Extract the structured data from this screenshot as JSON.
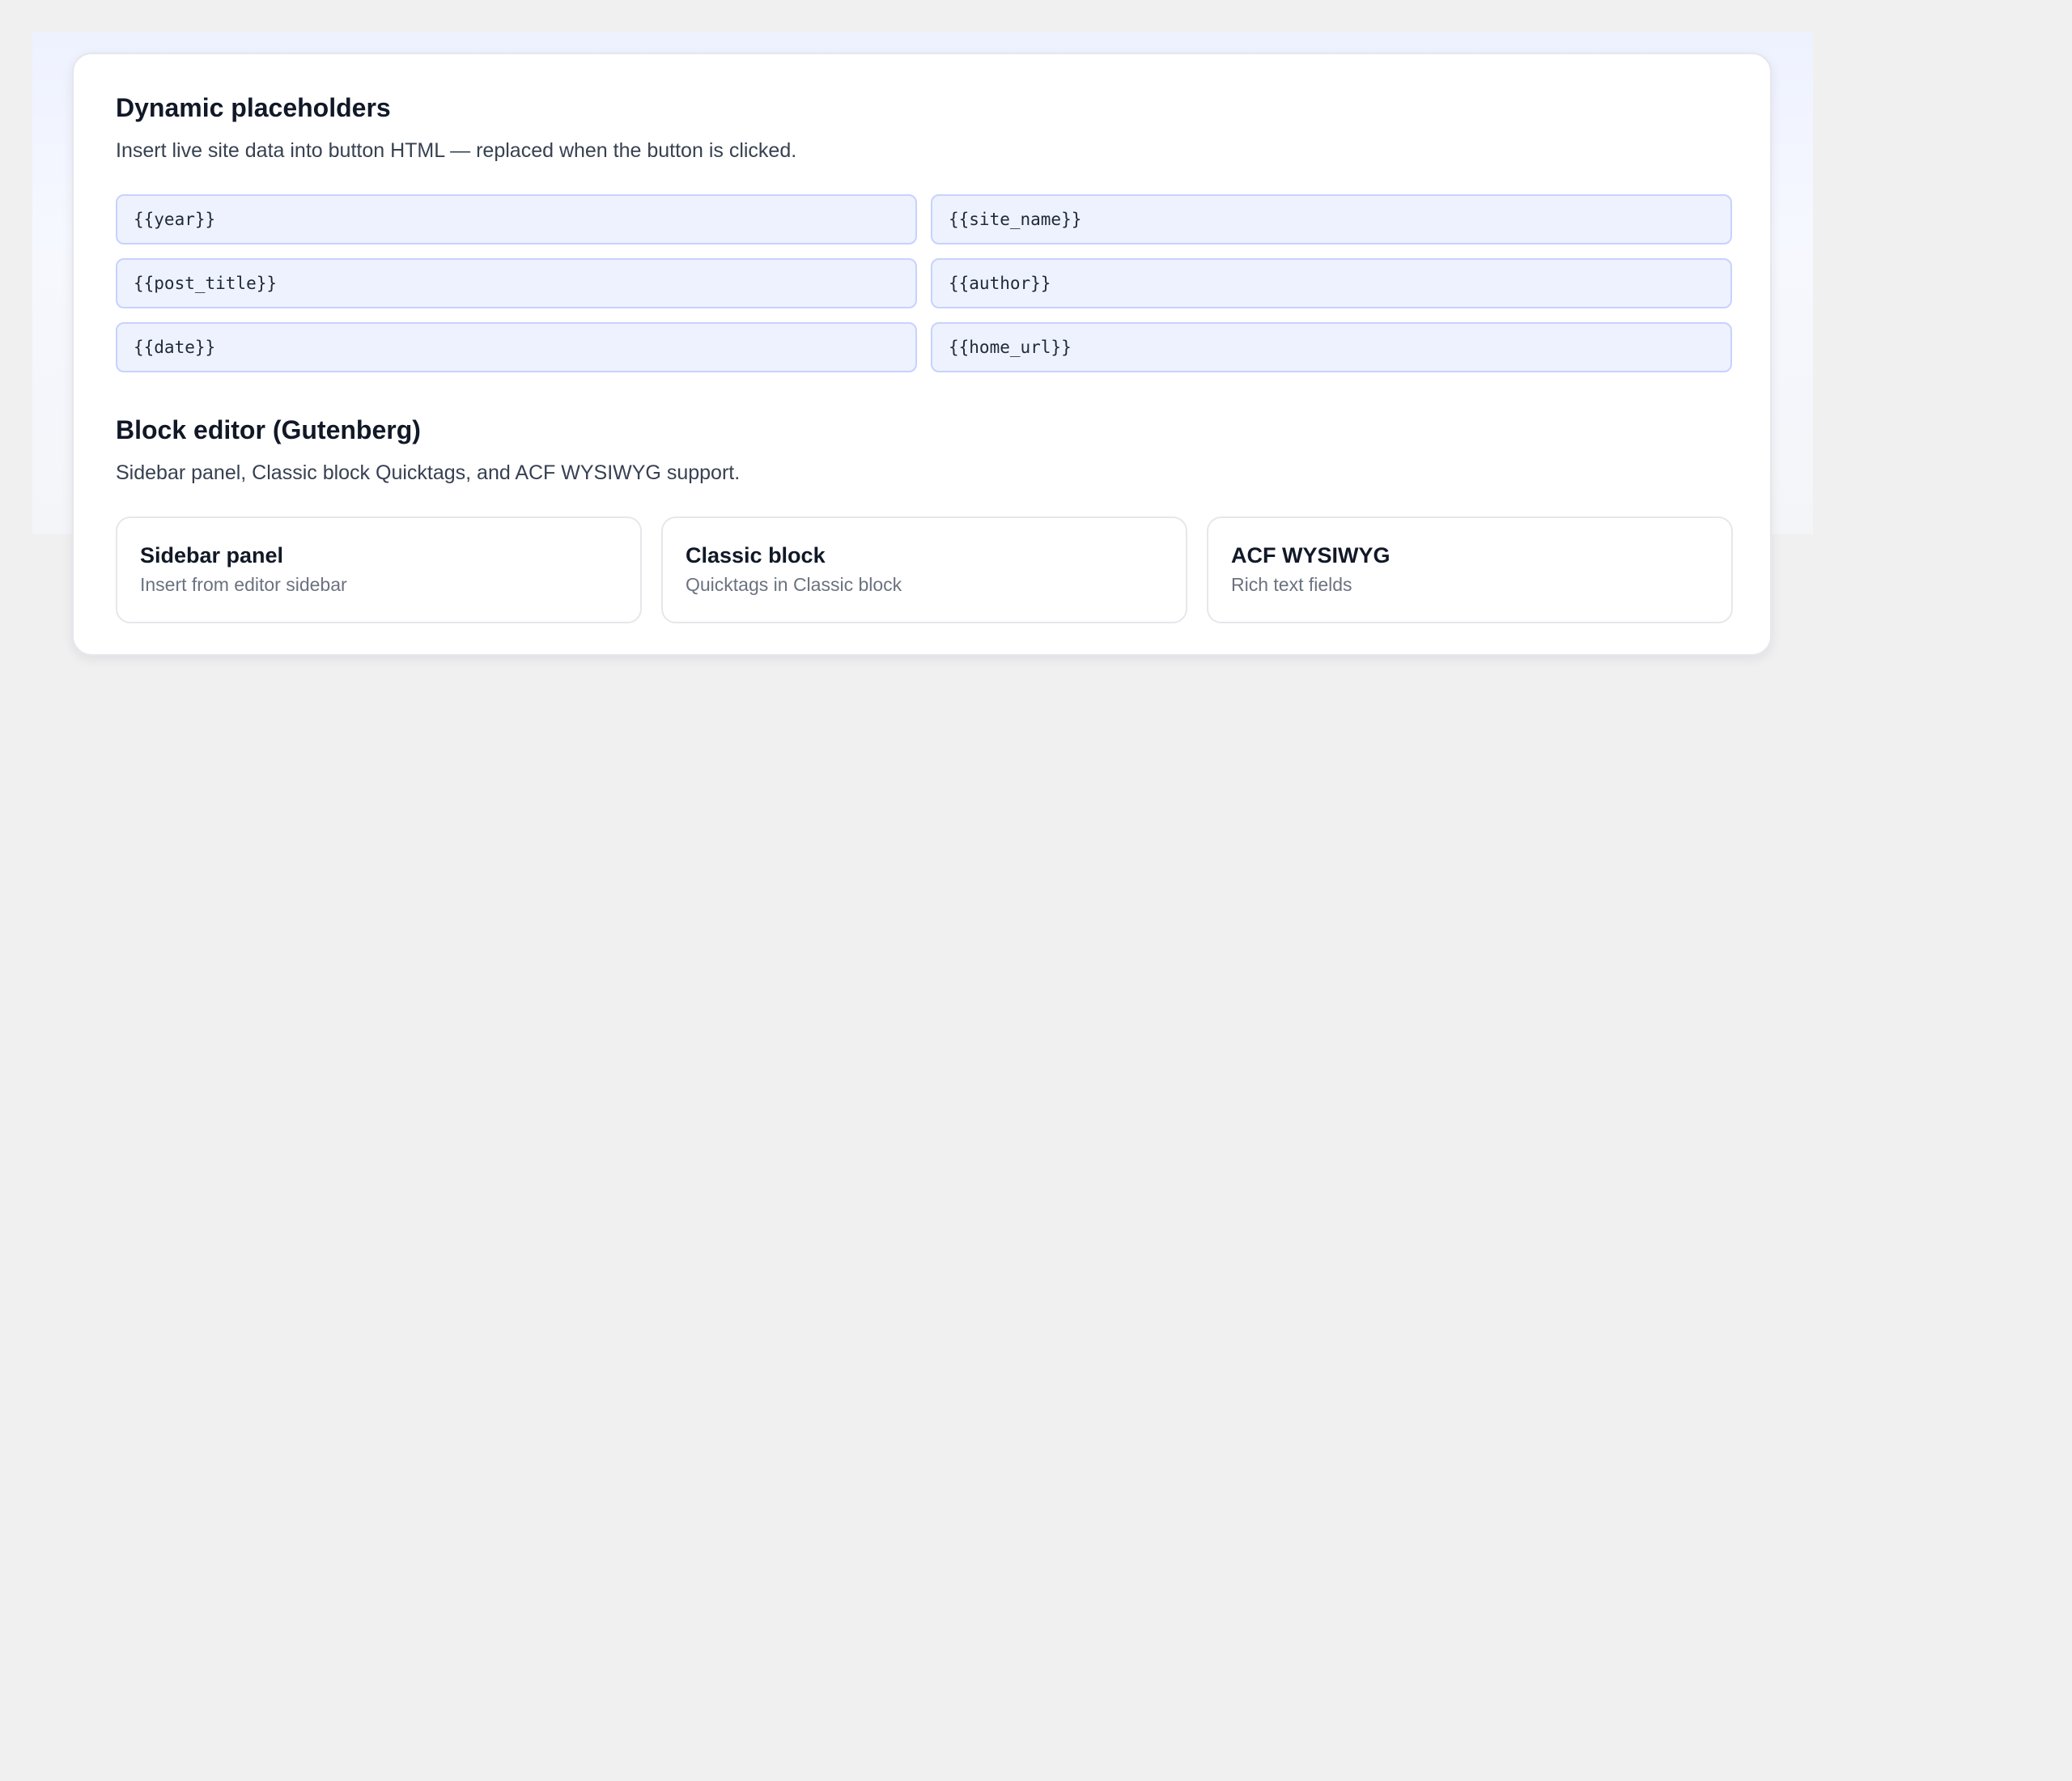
{
  "placeholders_section": {
    "title": "Dynamic placeholders",
    "description": "Insert live site data into button HTML — replaced when the button is clicked.",
    "tokens": [
      "{{year}}",
      "{{site_name}}",
      "{{post_title}}",
      "{{author}}",
      "{{date}}",
      "{{home_url}}"
    ]
  },
  "block_editor_section": {
    "title": "Block editor (Gutenberg)",
    "description": "Sidebar panel, Classic block Quicktags, and ACF WYSIWYG support.",
    "features": [
      {
        "title": "Sidebar panel",
        "subtitle": "Insert from editor sidebar"
      },
      {
        "title": "Classic block",
        "subtitle": "Quicktags in Classic block"
      },
      {
        "title": "ACF WYSIWYG",
        "subtitle": "Rich text fields"
      }
    ]
  },
  "colors": {
    "page_background": "#f0f0f1",
    "card_background": "#ffffff",
    "chip_background": "#eef2ff",
    "chip_border": "#c7d2fe",
    "heading_text": "#111827",
    "muted_text": "#6b7280"
  }
}
